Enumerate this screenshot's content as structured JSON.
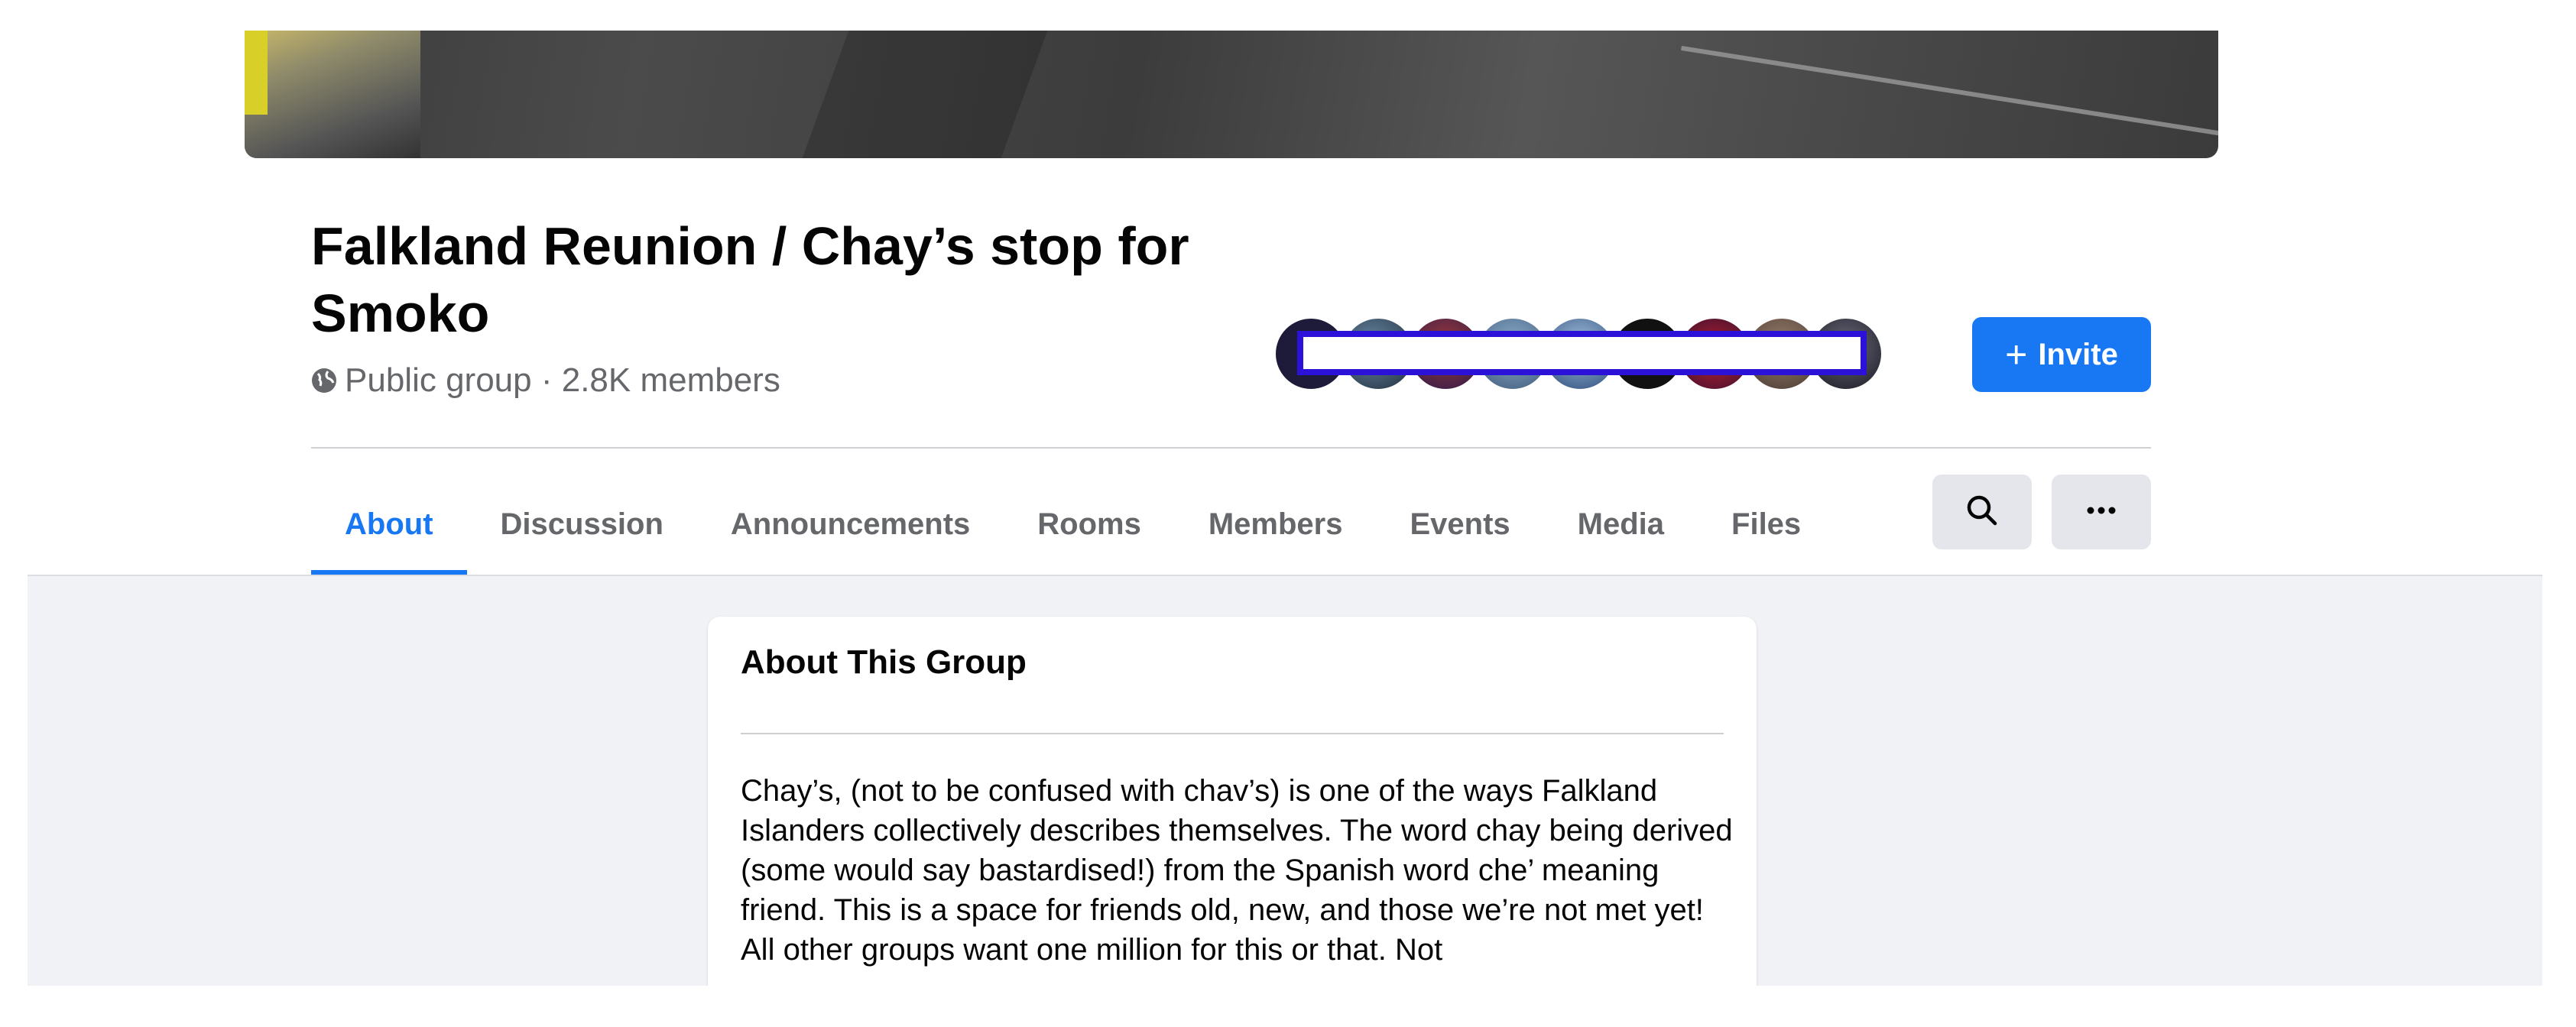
{
  "group": {
    "name": "Falkland Reunion / Chay’s stop for Smoko",
    "privacy": "Public group",
    "separator": " · ",
    "members": "2.8K members"
  },
  "actions": {
    "invite_label": "Invite"
  },
  "tabs": [
    {
      "label": "About",
      "active": true
    },
    {
      "label": "Discussion",
      "active": false
    },
    {
      "label": "Announcements",
      "active": false
    },
    {
      "label": "Rooms",
      "active": false
    },
    {
      "label": "Members",
      "active": false
    },
    {
      "label": "Events",
      "active": false
    },
    {
      "label": "Media",
      "active": false
    },
    {
      "label": "Files",
      "active": false
    }
  ],
  "about": {
    "heading": "About This Group",
    "description": "Chay’s, (not to be confused with chav’s) is one of the ways Falkland Islanders collectively describes themselves. The word chay being derived (some would say bastardised!) from the Spanish word che’ meaning friend. This is a space for friends old, new, and those we’re not met yet! All other groups want one million for this or that. Not"
  },
  "icons": {
    "privacy": "globe-icon",
    "search": "search-icon",
    "more": "more-icon",
    "invite": "plus-icon"
  },
  "colors": {
    "accent": "#1877f2",
    "secondary_text": "#65676b",
    "redaction_border": "#2c11d8",
    "page_gray": "#f0f2f5"
  }
}
